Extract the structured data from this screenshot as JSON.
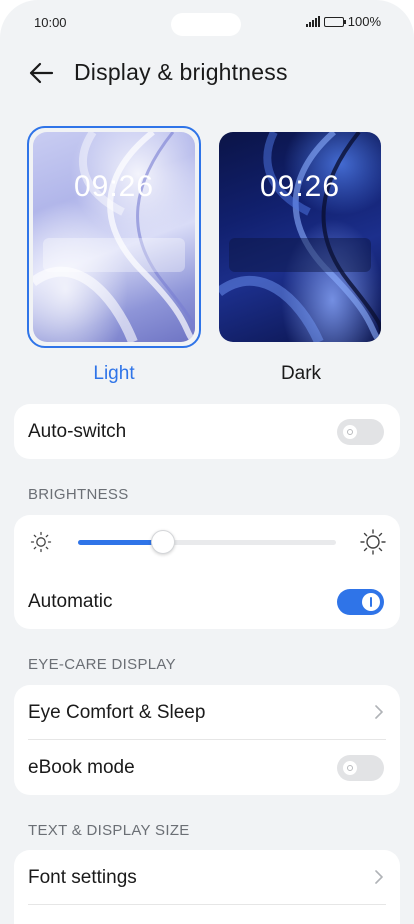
{
  "status_bar": {
    "time": "10:00",
    "battery": "100%"
  },
  "header": {
    "title": "Display & brightness"
  },
  "themes": [
    {
      "label": "Light",
      "clock": "09:26",
      "selected": true
    },
    {
      "label": "Dark",
      "clock": "09:26",
      "selected": false
    }
  ],
  "auto_switch": {
    "label": "Auto-switch",
    "on": false
  },
  "brightness": {
    "section_title": "BRIGHTNESS",
    "level": 0.33,
    "automatic": {
      "label": "Automatic",
      "on": true
    }
  },
  "eye_care": {
    "section_title": "EYE-CARE DISPLAY",
    "eye_comfort": {
      "label": "Eye Comfort & Sleep"
    },
    "ebook": {
      "label": "eBook mode",
      "on": false
    }
  },
  "text_display": {
    "section_title": "TEXT & DISPLAY SIZE",
    "font_settings": {
      "label": "Font settings"
    }
  },
  "colors": {
    "accent": "#2f74e8",
    "background": "#f1f3f5"
  },
  "icons": [
    "back-arrow-icon",
    "sun-small-icon",
    "sun-large-icon",
    "chevron-right-icon",
    "signal-icon",
    "battery-icon"
  ]
}
